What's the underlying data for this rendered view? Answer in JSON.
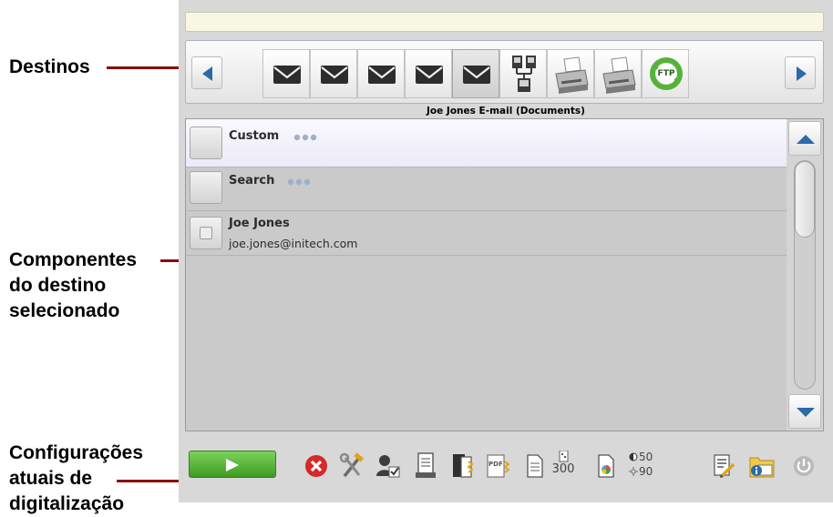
{
  "callouts": {
    "destinos": "Destinos",
    "componentes_line1": "Componentes",
    "componentes_line2": "do destino",
    "componentes_line3": "selecionado",
    "config_line1": "Configurações",
    "config_line2": "atuais de",
    "config_line3": "digitalização"
  },
  "status_bar": {
    "text": ""
  },
  "destinations": {
    "prev_icon": "triangle-left-icon",
    "next_icon": "triangle-right-icon",
    "items": [
      {
        "icon": "envelope-icon"
      },
      {
        "icon": "envelope-icon"
      },
      {
        "icon": "envelope-icon"
      },
      {
        "icon": "envelope-icon"
      },
      {
        "icon": "envelope-icon",
        "selected": true
      },
      {
        "icon": "network-icon"
      },
      {
        "icon": "printer-icon"
      },
      {
        "icon": "printer-icon"
      },
      {
        "icon": "ftp-icon",
        "label": "FTP"
      }
    ],
    "selected_title": "Joe Jones E-mail (Documents)"
  },
  "components": [
    {
      "label": "Custom",
      "has_more": true
    },
    {
      "label": "Search",
      "has_more": true
    },
    {
      "label": "Joe Jones",
      "subtitle": "joe.jones@initech.com",
      "has_checkbox": true
    }
  ],
  "toolbar": {
    "scan_icon": "play-icon",
    "cancel_icon": "cancel-icon",
    "settings_icon": "tools-icon",
    "user_icon": "user-check-icon",
    "scan_side_icon": "scanner-document-icon",
    "output_format_icon": "document-stack-icon",
    "pdf_label": "PDF",
    "document_icon": "single-document-icon",
    "resolution_value": "300",
    "color_icon": "color-document-icon",
    "brightness_value": "50",
    "contrast_value": "90",
    "edit_icon": "edit-list-icon",
    "info_icon": "folder-info-icon",
    "power_icon": "power-icon"
  },
  "colors": {
    "leader": "#8b0d0d",
    "go_button": "#4caa2c",
    "accent_blue": "#2b6aa8",
    "cancel_red": "#d42a2a"
  }
}
